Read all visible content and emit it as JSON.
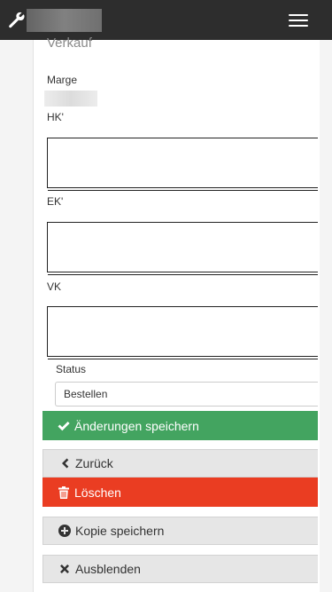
{
  "navbar": {
    "brand_icon": "wrench-icon",
    "menu_icon": "hamburger-menu-icon"
  },
  "panel": {
    "heading": "Verkauf",
    "fields": {
      "marge_label": "Marge",
      "hk_label": "HK'",
      "hk_value": "",
      "ek_label": "EK'",
      "ek_value": "",
      "vk_label": "VK",
      "vk_value": "",
      "status_label": "Status",
      "status_value": "Bestellen"
    }
  },
  "actions": {
    "save_label": "Änderungen speichern",
    "back_label": "Zurück",
    "delete_label": "Löschen",
    "copy_label": "Kopie speichern",
    "hide_label": "Ausblenden"
  },
  "colors": {
    "navbar_bg": "#2d2d2d",
    "save": "#43a460",
    "delete": "#ea3d22",
    "neutral": "#e6e6e6"
  }
}
